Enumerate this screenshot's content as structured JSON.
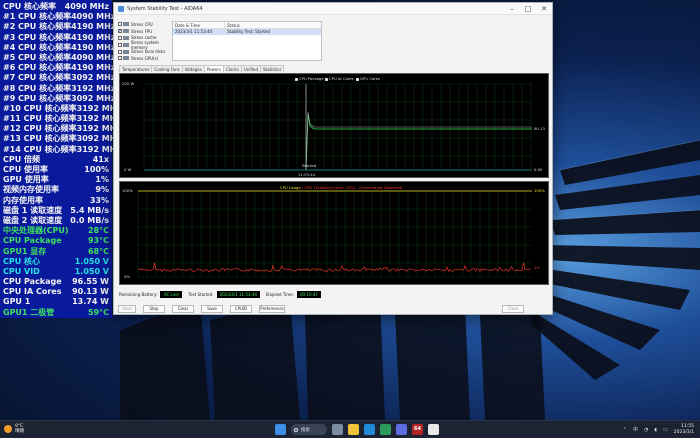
{
  "osd": [
    {
      "label": "CPU 核心频率",
      "value": "4090 MHz",
      "color": "white"
    },
    {
      "label": "#1 CPU 核心频率",
      "value": "4090 MHz",
      "color": "white"
    },
    {
      "label": "#2 CPU 核心频率",
      "value": "4190 MHz",
      "color": "white"
    },
    {
      "label": "#3 CPU 核心频率",
      "value": "4190 MHz",
      "color": "white"
    },
    {
      "label": "#4 CPU 核心频率",
      "value": "4190 MHz",
      "color": "white"
    },
    {
      "label": "#5 CPU 核心频率",
      "value": "4090 MHz",
      "color": "white"
    },
    {
      "label": "#6 CPU 核心频率",
      "value": "4190 MHz",
      "color": "white"
    },
    {
      "label": "#7 CPU 核心频率",
      "value": "3092 MHz",
      "color": "white"
    },
    {
      "label": "#8 CPU 核心频率",
      "value": "3192 MHz",
      "color": "white"
    },
    {
      "label": "#9 CPU 核心频率",
      "value": "3092 MHz",
      "color": "white"
    },
    {
      "label": "#10 CPU 核心频率",
      "value": "3192 MHz",
      "color": "white"
    },
    {
      "label": "#11 CPU 核心频率",
      "value": "3192 MHz",
      "color": "white"
    },
    {
      "label": "#12 CPU 核心频率",
      "value": "3192 MHz",
      "color": "white"
    },
    {
      "label": "#13 CPU 核心频率",
      "value": "3092 MHz",
      "color": "white"
    },
    {
      "label": "#14 CPU 核心频率",
      "value": "3192 MHz",
      "color": "white"
    },
    {
      "label": "CPU 倍频",
      "value": "41x",
      "color": "white"
    },
    {
      "label": "CPU 使用率",
      "value": "100%",
      "color": "white"
    },
    {
      "label": "GPU 使用率",
      "value": "1%",
      "color": "white"
    },
    {
      "label": "视频内存使用率",
      "value": "9%",
      "color": "white"
    },
    {
      "label": "内存使用率",
      "value": "33%",
      "color": "white"
    },
    {
      "label": "磁盘 1 读取速度",
      "value": "5.4 MB/s",
      "color": "white"
    },
    {
      "label": "磁盘 2 读取速度",
      "value": "0.0 MB/s",
      "color": "white"
    },
    {
      "label": "中央处理器(CPU)",
      "value": "28°C",
      "color": "green"
    },
    {
      "label": "CPU Package",
      "value": "93°C",
      "color": "green"
    },
    {
      "label": "GPU1 显存",
      "value": "68°C",
      "color": "green"
    },
    {
      "label": "CPU 核心",
      "value": "1.050 V",
      "color": "cyan"
    },
    {
      "label": "CPU VID",
      "value": "1.050 V",
      "color": "cyan"
    },
    {
      "label": "CPU Package",
      "value": "96.55 W",
      "color": "white"
    },
    {
      "label": "CPU IA Cores",
      "value": "90.13 W",
      "color": "white"
    },
    {
      "label": "GPU 1",
      "value": "13.74 W",
      "color": "white"
    },
    {
      "label": "GPU1 二极管",
      "value": "59°C",
      "color": "green"
    }
  ],
  "window": {
    "title": "System Stability Test - AIDA64",
    "stress_options": [
      {
        "label": "Stress CPU",
        "checked": false
      },
      {
        "label": "Stress FPU",
        "checked": true
      },
      {
        "label": "Stress cache",
        "checked": false
      },
      {
        "label": "Stress system memory",
        "checked": false
      },
      {
        "label": "Stress local disks",
        "checked": false
      },
      {
        "label": "Stress GPU(s)",
        "checked": false
      }
    ],
    "log": {
      "col_datetime": "Date & Time",
      "col_status": "Status",
      "rows": [
        {
          "datetime": "2023/3/1 11:53:44",
          "status": "Stability Test: Started"
        }
      ]
    },
    "tabs": [
      "Temperatures",
      "Cooling Fans",
      "Voltages",
      "Powers",
      "Clocks",
      "Unified",
      "Statistics"
    ],
    "active_tab": "Powers",
    "graph1": {
      "legend": [
        "CPU Package",
        "CPU IA Cores",
        "GPU Cores"
      ],
      "y_top": "200 W",
      "y_bottom": "0 W",
      "right_mid": "90.13",
      "right_low": "0.00",
      "time": "11:53:44",
      "event": "Started"
    },
    "graph2": {
      "title_part1": "CPU Usage",
      "title_part2": "CPU Throttling (max: 25%) - Overheating Detected!",
      "y_top_left": "100%",
      "y_bottom_left": "0%",
      "y_top_right": "100%",
      "y_bottom_right": "1%"
    },
    "status": {
      "remaining_battery_label": "Remaining Battery:",
      "remaining_battery": "AC Line",
      "test_started_label": "Test Started:",
      "test_started": "2023/3/1 11:53:44",
      "elapsed_time_label": "Elapsed Time:",
      "elapsed_time": "00:10:47"
    },
    "buttons": {
      "start": "Start",
      "stop": "Stop",
      "clear": "Clear",
      "save": "Save",
      "cpuid": "CPUID",
      "preferences": "Preferences",
      "close": "Close"
    }
  },
  "taskbar": {
    "weather_temp": "9°C",
    "weather_desc": "晴朗",
    "search": "搜索",
    "aida_label": "64",
    "tray_lang": "中",
    "time": "11:55",
    "date": "2023/3/1"
  },
  "colors": {
    "osd_bg": "#0a1a9c",
    "osd_green": "#3ee060",
    "osd_cyan": "#26e0e6",
    "graph_green": "#3ee060",
    "graph_red": "#ff3a2e",
    "graph_yellow": "#f0e22a"
  }
}
